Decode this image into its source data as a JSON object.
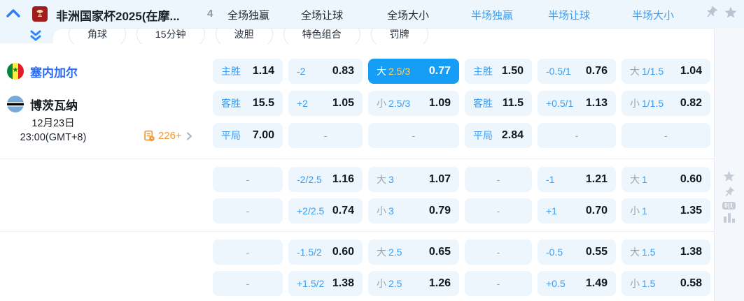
{
  "header": {
    "title": "非洲国家杯2025(在摩...",
    "match_count": "4",
    "tabs": [
      {
        "label": "全场独赢",
        "style": "dark"
      },
      {
        "label": "全场让球",
        "style": "dark"
      },
      {
        "label": "全场大小",
        "style": "dark"
      },
      {
        "label": "半场独赢",
        "style": "blue"
      },
      {
        "label": "半场让球",
        "style": "blue"
      },
      {
        "label": "半场大小",
        "style": "blue"
      }
    ]
  },
  "filter_pills": [
    "角球",
    "15分钟",
    "波胆",
    "特色组合",
    "罚牌"
  ],
  "match": {
    "home": {
      "name": "塞内加尔",
      "flag": "senegal-flag"
    },
    "away": {
      "name": "博茨瓦纳",
      "flag": "botswana-flag"
    },
    "date_line1": "12月23日",
    "date_line2": "23:00(GMT+8)",
    "markets_count": "226+"
  },
  "dash_char": "-",
  "side_toolbar": {
    "score_badge": "0|1"
  },
  "colors": {
    "accent_blue": "#3d9ef2",
    "selected_blue": "#169df5",
    "selected_gold": "#fdd05a",
    "orange": "#f7982f",
    "value_dark": "#13181f"
  },
  "odds_sections": [
    {
      "rows": [
        [
          {
            "t": "named",
            "label": "主胜",
            "value": "1.14"
          },
          {
            "t": "hcp",
            "label": "-2",
            "value": "0.83"
          },
          {
            "t": "ou",
            "prefix": "大",
            "line": "2.5/3",
            "value": "0.77",
            "selected": true
          },
          {
            "t": "named",
            "label": "主胜",
            "value": "1.50"
          },
          {
            "t": "hcp",
            "label": "-0.5/1",
            "value": "0.76"
          },
          {
            "t": "ou",
            "prefix": "大",
            "line": "1/1.5",
            "value": "1.04"
          }
        ],
        [
          {
            "t": "named",
            "label": "客胜",
            "value": "15.5"
          },
          {
            "t": "hcp",
            "label": "+2",
            "value": "1.05"
          },
          {
            "t": "ou",
            "prefix": "小",
            "line": "2.5/3",
            "value": "1.09"
          },
          {
            "t": "named",
            "label": "客胜",
            "value": "11.5"
          },
          {
            "t": "hcp",
            "label": "+0.5/1",
            "value": "1.13"
          },
          {
            "t": "ou",
            "prefix": "小",
            "line": "1/1.5",
            "value": "0.82"
          }
        ],
        [
          {
            "t": "named",
            "label": "平局",
            "value": "7.00"
          },
          {
            "t": "dash"
          },
          {
            "t": "dash"
          },
          {
            "t": "named",
            "label": "平局",
            "value": "2.84"
          },
          {
            "t": "dash"
          },
          {
            "t": "dash"
          }
        ]
      ]
    },
    {
      "rows": [
        [
          {
            "t": "dash"
          },
          {
            "t": "hcp",
            "label": "-2/2.5",
            "value": "1.16"
          },
          {
            "t": "ou",
            "prefix": "大",
            "line": "3",
            "value": "1.07"
          },
          {
            "t": "dash"
          },
          {
            "t": "hcp",
            "label": "-1",
            "value": "1.21"
          },
          {
            "t": "ou",
            "prefix": "大",
            "line": "1",
            "value": "0.60"
          }
        ],
        [
          {
            "t": "dash"
          },
          {
            "t": "hcp",
            "label": "+2/2.5",
            "value": "0.74"
          },
          {
            "t": "ou",
            "prefix": "小",
            "line": "3",
            "value": "0.79"
          },
          {
            "t": "dash"
          },
          {
            "t": "hcp",
            "label": "+1",
            "value": "0.70"
          },
          {
            "t": "ou",
            "prefix": "小",
            "line": "1",
            "value": "1.35"
          }
        ]
      ]
    },
    {
      "rows": [
        [
          {
            "t": "dash"
          },
          {
            "t": "hcp",
            "label": "-1.5/2",
            "value": "0.60"
          },
          {
            "t": "ou",
            "prefix": "大",
            "line": "2.5",
            "value": "0.65"
          },
          {
            "t": "dash"
          },
          {
            "t": "hcp",
            "label": "-0.5",
            "value": "0.55"
          },
          {
            "t": "ou",
            "prefix": "大",
            "line": "1.5",
            "value": "1.38"
          }
        ],
        [
          {
            "t": "dash"
          },
          {
            "t": "hcp",
            "label": "+1.5/2",
            "value": "1.38"
          },
          {
            "t": "ou",
            "prefix": "小",
            "line": "2.5",
            "value": "1.26"
          },
          {
            "t": "dash"
          },
          {
            "t": "hcp",
            "label": "+0.5",
            "value": "1.49"
          },
          {
            "t": "ou",
            "prefix": "小",
            "line": "1.5",
            "value": "0.58"
          }
        ]
      ]
    }
  ]
}
